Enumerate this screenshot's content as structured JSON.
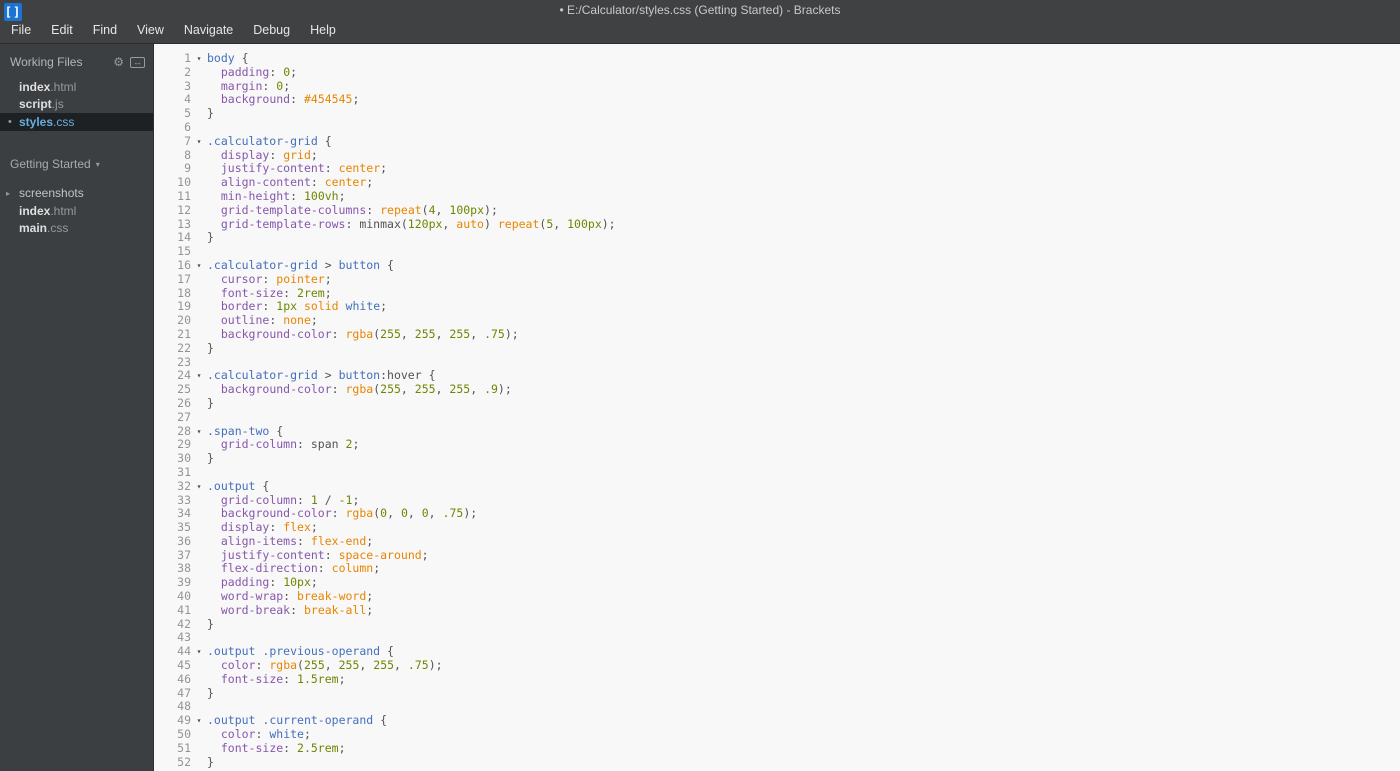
{
  "window": {
    "title": "• E:/Calculator/styles.css (Getting Started) - Brackets",
    "app_icon": "brackets-logo",
    "app_icon_glyph": "[]"
  },
  "menu": {
    "items": [
      "File",
      "Edit",
      "Find",
      "View",
      "Navigate",
      "Debug",
      "Help"
    ]
  },
  "sidebar": {
    "working_files": {
      "label": "Working Files",
      "gear_icon_glyph": "⚙",
      "split_icon_glyph": "↔",
      "dirty_glyph": "•",
      "files": [
        {
          "name": "index",
          "ext": ".html",
          "active": false,
          "dirty": false
        },
        {
          "name": "script",
          "ext": ".js",
          "active": false,
          "dirty": false
        },
        {
          "name": "styles",
          "ext": ".css",
          "active": true,
          "dirty": true
        }
      ]
    },
    "project": {
      "name": "Getting Started",
      "dropdown_glyph": "▾",
      "collapsed_glyph": "▸",
      "items": [
        {
          "kind": "folder",
          "label": "screenshots"
        },
        {
          "kind": "file",
          "name": "index",
          "ext": ".html"
        },
        {
          "kind": "file",
          "name": "main",
          "ext": ".css"
        }
      ]
    }
  },
  "editor": {
    "file": "styles.css",
    "fold_glyph": "▾",
    "lines": [
      {
        "n": 1,
        "f": true,
        "t": [
          [
            "b",
            "body"
          ],
          [
            "t",
            " {"
          ]
        ]
      },
      {
        "n": 2,
        "t": [
          [
            "t",
            "  "
          ],
          [
            "p",
            "padding"
          ],
          [
            "t",
            ": "
          ],
          [
            "n",
            "0"
          ],
          [
            "t",
            ";"
          ]
        ]
      },
      {
        "n": 3,
        "t": [
          [
            "t",
            "  "
          ],
          [
            "p",
            "margin"
          ],
          [
            "t",
            ": "
          ],
          [
            "n",
            "0"
          ],
          [
            "t",
            ";"
          ]
        ]
      },
      {
        "n": 4,
        "t": [
          [
            "t",
            "  "
          ],
          [
            "p",
            "background"
          ],
          [
            "t",
            ": "
          ],
          [
            "a",
            "#454545"
          ],
          [
            "t",
            ";"
          ]
        ]
      },
      {
        "n": 5,
        "t": [
          [
            "t",
            "}"
          ]
        ]
      },
      {
        "n": 6,
        "t": []
      },
      {
        "n": 7,
        "f": true,
        "t": [
          [
            "b",
            ".calculator-grid"
          ],
          [
            "t",
            " {"
          ]
        ]
      },
      {
        "n": 8,
        "t": [
          [
            "t",
            "  "
          ],
          [
            "p",
            "display"
          ],
          [
            "t",
            ": "
          ],
          [
            "a",
            "grid"
          ],
          [
            "t",
            ";"
          ]
        ]
      },
      {
        "n": 9,
        "t": [
          [
            "t",
            "  "
          ],
          [
            "p",
            "justify-content"
          ],
          [
            "t",
            ": "
          ],
          [
            "a",
            "center"
          ],
          [
            "t",
            ";"
          ]
        ]
      },
      {
        "n": 10,
        "t": [
          [
            "t",
            "  "
          ],
          [
            "p",
            "align-content"
          ],
          [
            "t",
            ": "
          ],
          [
            "a",
            "center"
          ],
          [
            "t",
            ";"
          ]
        ]
      },
      {
        "n": 11,
        "t": [
          [
            "t",
            "  "
          ],
          [
            "p",
            "min-height"
          ],
          [
            "t",
            ": "
          ],
          [
            "n",
            "100vh"
          ],
          [
            "t",
            ";"
          ]
        ]
      },
      {
        "n": 12,
        "t": [
          [
            "t",
            "  "
          ],
          [
            "p",
            "grid-template-columns"
          ],
          [
            "t",
            ": "
          ],
          [
            "a",
            "repeat"
          ],
          [
            "t",
            "("
          ],
          [
            "n",
            "4"
          ],
          [
            "t",
            ", "
          ],
          [
            "n",
            "100px"
          ],
          [
            "t",
            ");"
          ]
        ]
      },
      {
        "n": 13,
        "t": [
          [
            "t",
            "  "
          ],
          [
            "p",
            "grid-template-rows"
          ],
          [
            "t",
            ": minmax("
          ],
          [
            "n",
            "120px"
          ],
          [
            "t",
            ", "
          ],
          [
            "a",
            "auto"
          ],
          [
            "t",
            ") "
          ],
          [
            "a",
            "repeat"
          ],
          [
            "t",
            "("
          ],
          [
            "n",
            "5"
          ],
          [
            "t",
            ", "
          ],
          [
            "n",
            "100px"
          ],
          [
            "t",
            ");"
          ]
        ]
      },
      {
        "n": 14,
        "t": [
          [
            "t",
            "}"
          ]
        ]
      },
      {
        "n": 15,
        "t": []
      },
      {
        "n": 16,
        "f": true,
        "t": [
          [
            "b",
            ".calculator-grid"
          ],
          [
            "t",
            " > "
          ],
          [
            "b",
            "button"
          ],
          [
            "t",
            " {"
          ]
        ]
      },
      {
        "n": 17,
        "t": [
          [
            "t",
            "  "
          ],
          [
            "p",
            "cursor"
          ],
          [
            "t",
            ": "
          ],
          [
            "a",
            "pointer"
          ],
          [
            "t",
            ";"
          ]
        ]
      },
      {
        "n": 18,
        "t": [
          [
            "t",
            "  "
          ],
          [
            "p",
            "font-size"
          ],
          [
            "t",
            ": "
          ],
          [
            "n",
            "2rem"
          ],
          [
            "t",
            ";"
          ]
        ]
      },
      {
        "n": 19,
        "t": [
          [
            "t",
            "  "
          ],
          [
            "p",
            "border"
          ],
          [
            "t",
            ": "
          ],
          [
            "n",
            "1px"
          ],
          [
            "t",
            " "
          ],
          [
            "a",
            "solid"
          ],
          [
            "t",
            " "
          ],
          [
            "b",
            "white"
          ],
          [
            "t",
            ";"
          ]
        ]
      },
      {
        "n": 20,
        "t": [
          [
            "t",
            "  "
          ],
          [
            "p",
            "outline"
          ],
          [
            "t",
            ": "
          ],
          [
            "a",
            "none"
          ],
          [
            "t",
            ";"
          ]
        ]
      },
      {
        "n": 21,
        "t": [
          [
            "t",
            "  "
          ],
          [
            "p",
            "background-color"
          ],
          [
            "t",
            ": "
          ],
          [
            "a",
            "rgba"
          ],
          [
            "t",
            "("
          ],
          [
            "n",
            "255"
          ],
          [
            "t",
            ", "
          ],
          [
            "n",
            "255"
          ],
          [
            "t",
            ", "
          ],
          [
            "n",
            "255"
          ],
          [
            "t",
            ", "
          ],
          [
            "n",
            ".75"
          ],
          [
            "t",
            ");"
          ]
        ]
      },
      {
        "n": 22,
        "t": [
          [
            "t",
            "}"
          ]
        ]
      },
      {
        "n": 23,
        "t": []
      },
      {
        "n": 24,
        "f": true,
        "t": [
          [
            "b",
            ".calculator-grid"
          ],
          [
            "t",
            " > "
          ],
          [
            "b",
            "button"
          ],
          [
            "t",
            ":hover {"
          ]
        ]
      },
      {
        "n": 25,
        "t": [
          [
            "t",
            "  "
          ],
          [
            "p",
            "background-color"
          ],
          [
            "t",
            ": "
          ],
          [
            "a",
            "rgba"
          ],
          [
            "t",
            "("
          ],
          [
            "n",
            "255"
          ],
          [
            "t",
            ", "
          ],
          [
            "n",
            "255"
          ],
          [
            "t",
            ", "
          ],
          [
            "n",
            "255"
          ],
          [
            "t",
            ", "
          ],
          [
            "n",
            ".9"
          ],
          [
            "t",
            ");"
          ]
        ]
      },
      {
        "n": 26,
        "t": [
          [
            "t",
            "}"
          ]
        ]
      },
      {
        "n": 27,
        "t": []
      },
      {
        "n": 28,
        "f": true,
        "t": [
          [
            "b",
            ".span-two"
          ],
          [
            "t",
            " {"
          ]
        ]
      },
      {
        "n": 29,
        "t": [
          [
            "t",
            "  "
          ],
          [
            "p",
            "grid-column"
          ],
          [
            "t",
            ": span "
          ],
          [
            "n",
            "2"
          ],
          [
            "t",
            ";"
          ]
        ]
      },
      {
        "n": 30,
        "t": [
          [
            "t",
            "}"
          ]
        ]
      },
      {
        "n": 31,
        "t": []
      },
      {
        "n": 32,
        "f": true,
        "t": [
          [
            "b",
            ".output"
          ],
          [
            "t",
            " {"
          ]
        ]
      },
      {
        "n": 33,
        "t": [
          [
            "t",
            "  "
          ],
          [
            "p",
            "grid-column"
          ],
          [
            "t",
            ": "
          ],
          [
            "n",
            "1"
          ],
          [
            "t",
            " / "
          ],
          [
            "n",
            "-1"
          ],
          [
            "t",
            ";"
          ]
        ]
      },
      {
        "n": 34,
        "t": [
          [
            "t",
            "  "
          ],
          [
            "p",
            "background-color"
          ],
          [
            "t",
            ": "
          ],
          [
            "a",
            "rgba"
          ],
          [
            "t",
            "("
          ],
          [
            "n",
            "0"
          ],
          [
            "t",
            ", "
          ],
          [
            "n",
            "0"
          ],
          [
            "t",
            ", "
          ],
          [
            "n",
            "0"
          ],
          [
            "t",
            ", "
          ],
          [
            "n",
            ".75"
          ],
          [
            "t",
            ");"
          ]
        ]
      },
      {
        "n": 35,
        "t": [
          [
            "t",
            "  "
          ],
          [
            "p",
            "display"
          ],
          [
            "t",
            ": "
          ],
          [
            "a",
            "flex"
          ],
          [
            "t",
            ";"
          ]
        ]
      },
      {
        "n": 36,
        "t": [
          [
            "t",
            "  "
          ],
          [
            "p",
            "align-items"
          ],
          [
            "t",
            ": "
          ],
          [
            "a",
            "flex-end"
          ],
          [
            "t",
            ";"
          ]
        ]
      },
      {
        "n": 37,
        "t": [
          [
            "t",
            "  "
          ],
          [
            "p",
            "justify-content"
          ],
          [
            "t",
            ": "
          ],
          [
            "a",
            "space-around"
          ],
          [
            "t",
            ";"
          ]
        ]
      },
      {
        "n": 38,
        "t": [
          [
            "t",
            "  "
          ],
          [
            "p",
            "flex-direction"
          ],
          [
            "t",
            ": "
          ],
          [
            "a",
            "column"
          ],
          [
            "t",
            ";"
          ]
        ]
      },
      {
        "n": 39,
        "t": [
          [
            "t",
            "  "
          ],
          [
            "p",
            "padding"
          ],
          [
            "t",
            ": "
          ],
          [
            "n",
            "10px"
          ],
          [
            "t",
            ";"
          ]
        ]
      },
      {
        "n": 40,
        "t": [
          [
            "t",
            "  "
          ],
          [
            "p",
            "word-wrap"
          ],
          [
            "t",
            ": "
          ],
          [
            "a",
            "break-word"
          ],
          [
            "t",
            ";"
          ]
        ]
      },
      {
        "n": 41,
        "t": [
          [
            "t",
            "  "
          ],
          [
            "p",
            "word-break"
          ],
          [
            "t",
            ": "
          ],
          [
            "a",
            "break-all"
          ],
          [
            "t",
            ";"
          ]
        ]
      },
      {
        "n": 42,
        "t": [
          [
            "t",
            "}"
          ]
        ]
      },
      {
        "n": 43,
        "t": []
      },
      {
        "n": 44,
        "f": true,
        "t": [
          [
            "b",
            ".output"
          ],
          [
            "t",
            " "
          ],
          [
            "b",
            ".previous-operand"
          ],
          [
            "t",
            " {"
          ]
        ]
      },
      {
        "n": 45,
        "t": [
          [
            "t",
            "  "
          ],
          [
            "p",
            "color"
          ],
          [
            "t",
            ": "
          ],
          [
            "a",
            "rgba"
          ],
          [
            "t",
            "("
          ],
          [
            "n",
            "255"
          ],
          [
            "t",
            ", "
          ],
          [
            "n",
            "255"
          ],
          [
            "t",
            ", "
          ],
          [
            "n",
            "255"
          ],
          [
            "t",
            ", "
          ],
          [
            "n",
            ".75"
          ],
          [
            "t",
            ");"
          ]
        ]
      },
      {
        "n": 46,
        "t": [
          [
            "t",
            "  "
          ],
          [
            "p",
            "font-size"
          ],
          [
            "t",
            ": "
          ],
          [
            "n",
            "1.5rem"
          ],
          [
            "t",
            ";"
          ]
        ]
      },
      {
        "n": 47,
        "t": [
          [
            "t",
            "}"
          ]
        ]
      },
      {
        "n": 48,
        "t": []
      },
      {
        "n": 49,
        "f": true,
        "t": [
          [
            "b",
            ".output"
          ],
          [
            "t",
            " "
          ],
          [
            "b",
            ".current-operand"
          ],
          [
            "t",
            " {"
          ]
        ]
      },
      {
        "n": 50,
        "t": [
          [
            "t",
            "  "
          ],
          [
            "p",
            "color"
          ],
          [
            "t",
            ": "
          ],
          [
            "b",
            "white"
          ],
          [
            "t",
            ";"
          ]
        ]
      },
      {
        "n": 51,
        "t": [
          [
            "t",
            "  "
          ],
          [
            "p",
            "font-size"
          ],
          [
            "t",
            ": "
          ],
          [
            "n",
            "2.5rem"
          ],
          [
            "t",
            ";"
          ]
        ]
      },
      {
        "n": 52,
        "t": [
          [
            "t",
            "}"
          ]
        ]
      }
    ]
  },
  "colors": {
    "chrome_bg": "#3f4143",
    "sidebar_bg": "#3c3f41",
    "editor_bg": "#f8f8f8",
    "active_file_bg": "#1e2123",
    "active_file_text": "#66aee0",
    "brackets_icon_blue": "#1b74d1",
    "line_number": "#949494",
    "syntax_plain": "#535353",
    "syntax_blue": "#446fbd",
    "syntax_purple": "#8757ad",
    "syntax_green": "#6d8600",
    "syntax_orange": "#e88501"
  }
}
